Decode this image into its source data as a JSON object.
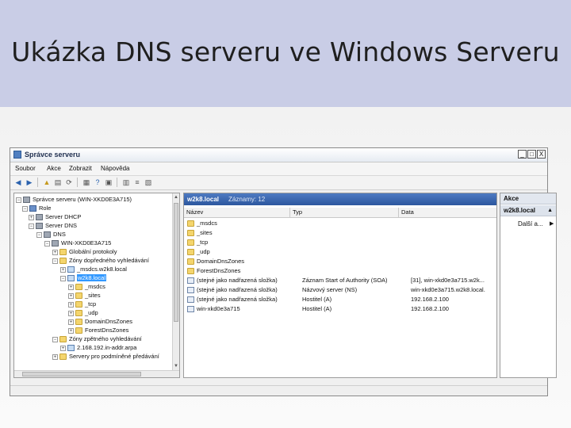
{
  "slide": {
    "title": "Ukázka DNS serveru ve Windows Serveru"
  },
  "window": {
    "title": "Správce serveru",
    "buttons": [
      "_",
      "□",
      "X"
    ]
  },
  "menu": [
    "Soubor",
    "Akce",
    "Zobrazit",
    "Nápověda"
  ],
  "toolbar_icons": [
    "back-arrow-icon",
    "forward-arrow-icon",
    "up-folder-icon",
    "show-hide-tree-icon",
    "refresh-icon",
    "export-icon",
    "help-icon",
    "properties-icon",
    "dns-record-icon",
    "list-icon",
    "delete-icon"
  ],
  "tree": [
    {
      "label": "Správce serveru (WIN-XKD0E3A715)",
      "icon": "server-manager-icon",
      "level": 0,
      "toggle": "−"
    },
    {
      "label": "Role",
      "icon": "roles-icon",
      "level": 1,
      "toggle": "−"
    },
    {
      "label": "Server DHCP",
      "icon": "server-icon",
      "level": 2,
      "toggle": "+"
    },
    {
      "label": "Server DNS",
      "icon": "server-icon",
      "level": 2,
      "toggle": "−"
    },
    {
      "label": "DNS",
      "icon": "server-icon",
      "level": 3,
      "toggle": "−"
    },
    {
      "label": "WIN-XKD0E3A715",
      "icon": "server-icon",
      "level": 4,
      "toggle": "−"
    },
    {
      "label": "Globální protokoly",
      "icon": "folder-icon",
      "level": 5,
      "toggle": "+"
    },
    {
      "label": "Zóny dopředného vyhledávání",
      "icon": "folder-icon",
      "level": 5,
      "toggle": "−"
    },
    {
      "label": "_msdcs.w2k8.local",
      "icon": "zone-icon",
      "level": 6,
      "toggle": "+"
    },
    {
      "label": "w2k8.local",
      "icon": "zone-icon",
      "level": 6,
      "toggle": "−",
      "selected": true
    },
    {
      "label": "_msdcs",
      "icon": "folder-icon",
      "level": 7,
      "toggle": "+"
    },
    {
      "label": "_sites",
      "icon": "folder-icon",
      "level": 7,
      "toggle": "+"
    },
    {
      "label": "_tcp",
      "icon": "folder-icon",
      "level": 7,
      "toggle": "+"
    },
    {
      "label": "_udp",
      "icon": "folder-icon",
      "level": 7,
      "toggle": "+"
    },
    {
      "label": "DomainDnsZones",
      "icon": "folder-icon",
      "level": 7,
      "toggle": "+"
    },
    {
      "label": "ForestDnsZones",
      "icon": "folder-icon",
      "level": 7,
      "toggle": "+"
    },
    {
      "label": "Zóny zpětného vyhledávání",
      "icon": "folder-icon",
      "level": 5,
      "toggle": "−"
    },
    {
      "label": "2.168.192.in-addr.arpa",
      "icon": "zone-icon",
      "level": 6,
      "toggle": "+"
    },
    {
      "label": "Servery pro podmíněné předávání",
      "icon": "folder-icon",
      "level": 5,
      "toggle": "+"
    }
  ],
  "list": {
    "header_title": "w2k8.local",
    "header_count": "Záznamy: 12",
    "columns": [
      "Název",
      "Typ",
      "Data"
    ],
    "rows": [
      {
        "icon": "folder-icon",
        "name": "_msdcs",
        "type": "",
        "data": ""
      },
      {
        "icon": "folder-icon",
        "name": "_sites",
        "type": "",
        "data": ""
      },
      {
        "icon": "folder-icon",
        "name": "_tcp",
        "type": "",
        "data": ""
      },
      {
        "icon": "folder-icon",
        "name": "_udp",
        "type": "",
        "data": ""
      },
      {
        "icon": "folder-icon",
        "name": "DomainDnsZones",
        "type": "",
        "data": ""
      },
      {
        "icon": "folder-icon",
        "name": "ForestDnsZones",
        "type": "",
        "data": ""
      },
      {
        "icon": "record-icon",
        "name": "(stejné jako nadřazená složka)",
        "type": "Záznam Start of Authority (SOA)",
        "data": "[31], win-xkd0e3a715.w2k..."
      },
      {
        "icon": "record-icon",
        "name": "(stejné jako nadřazená složka)",
        "type": "Názvový server (NS)",
        "data": "win-xkd0e3a715.w2k8.local."
      },
      {
        "icon": "record-icon",
        "name": "(stejné jako nadřazená složka)",
        "type": "Hostitel (A)",
        "data": "192.168.2.100"
      },
      {
        "icon": "record-icon",
        "name": "win-xkd0e3a715",
        "type": "Hostitel (A)",
        "data": "192.168.2.100"
      }
    ]
  },
  "actions": {
    "title": "Akce",
    "subtitle": "w2k8.local",
    "more": "Další a..."
  }
}
